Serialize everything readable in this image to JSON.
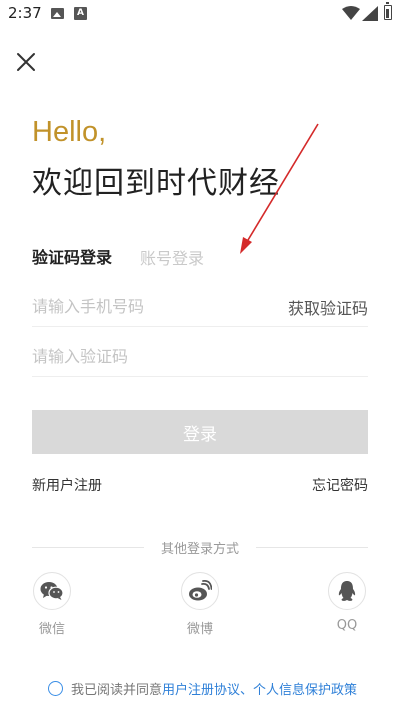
{
  "status_bar": {
    "time": "2:37",
    "a_icon_text": "A"
  },
  "header": {
    "hello": "Hello,",
    "welcome": "欢迎回到时代财经"
  },
  "tabs": {
    "sms_login": "验证码登录",
    "account_login": "账号登录"
  },
  "form": {
    "phone_placeholder": "请输入手机号码",
    "code_placeholder": "请输入验证码",
    "get_code_label": "获取验证码",
    "login_label": "登录"
  },
  "links": {
    "register": "新用户注册",
    "forgot": "忘记密码"
  },
  "other_login": {
    "title": "其他登录方式",
    "items": [
      {
        "label": "微信",
        "icon": "wechat-icon"
      },
      {
        "label": "微博",
        "icon": "weibo-icon"
      },
      {
        "label": "QQ",
        "icon": "qq-icon"
      }
    ]
  },
  "agreement": {
    "prefix": "我已阅读并同意",
    "user_agreement": "用户注册协议",
    "separator": "、",
    "privacy_policy": "个人信息保护政策"
  },
  "colors": {
    "hello": "#c1922a",
    "link": "#2f80d8",
    "login_button_disabled": "#d9d9d9",
    "annotation_arrow": "#d42a2a"
  }
}
